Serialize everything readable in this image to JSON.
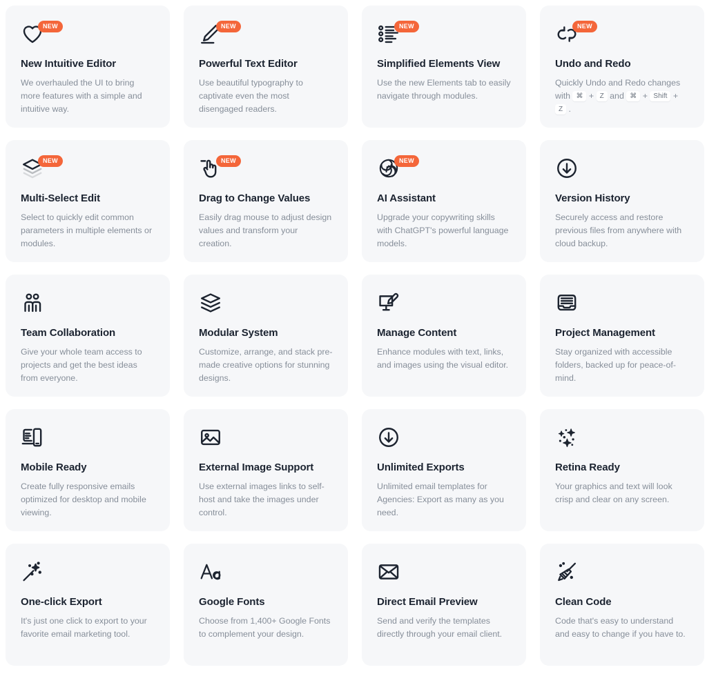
{
  "badge_label": "NEW",
  "accent_color": "#f4663a",
  "card_bg": "#f6f7f9",
  "title_color": "#1b2330",
  "desc_color": "#868e99",
  "cards": [
    {
      "icon": "heart-icon",
      "title": "New Intuitive Editor",
      "desc": "We overhauled the UI to bring more features with a simple and intuitive way.",
      "new": true
    },
    {
      "icon": "pencil-edit-icon",
      "title": "Powerful Text Editor",
      "desc": "Use beautiful typography to captivate even the most disengaged readers.",
      "new": true
    },
    {
      "icon": "elements-list-icon",
      "title": "Simplified Elements View",
      "desc": "Use the new Elements tab to easily navigate through modules.",
      "new": true
    },
    {
      "icon": "undo-redo-icon",
      "title": "Undo and Redo",
      "desc": "Quickly Undo and Redo changes with ",
      "desc_keys": [
        "⌘",
        "+",
        "Z",
        "and",
        "⌘",
        "+",
        "Shift",
        "+",
        "Z",
        "."
      ],
      "new": true
    },
    {
      "icon": "layers-stack-icon",
      "title": "Multi-Select Edit",
      "desc": "Select to quickly edit common parameters in multiple elements or modules.",
      "new": true
    },
    {
      "icon": "drag-hand-icon",
      "title": "Drag to Change Values",
      "desc": "Easily drag mouse to adjust design values and transform your creation.",
      "new": true
    },
    {
      "icon": "openai-spiral-icon",
      "title": "AI Assistant",
      "desc": "Upgrade your copywriting skills with ChatGPT's powerful language models.",
      "new": true
    },
    {
      "icon": "download-circle-icon",
      "title": "Version History",
      "desc": "Securely access and restore previous files from anywhere with cloud backup.",
      "new": false
    },
    {
      "icon": "team-people-icon",
      "title": "Team Collaboration",
      "desc": "Give your whole team access to projects and get the best ideas from everyone.",
      "new": false
    },
    {
      "icon": "modular-layers-icon",
      "title": "Modular System",
      "desc": "Customize, arrange, and stack pre-made creative options for stunning designs.",
      "new": false
    },
    {
      "icon": "monitor-brush-icon",
      "title": "Manage Content",
      "desc": "Enhance modules with text, links, and images using the visual editor.",
      "new": false
    },
    {
      "icon": "archive-tray-icon",
      "title": "Project Management",
      "desc": "Stay organized with accessible folders, backed up for peace-of-mind.",
      "new": false
    },
    {
      "icon": "mobile-device-icon",
      "title": "Mobile Ready",
      "desc": "Create fully responsive emails optimized for desktop and mobile viewing.",
      "new": false
    },
    {
      "icon": "image-picture-icon",
      "title": "External Image Support",
      "desc": "Use external images links to self-host and take the images under control.",
      "new": false
    },
    {
      "icon": "download-circle-icon",
      "title": "Unlimited Exports",
      "desc": "Unlimited email templates for Agencies: Export as many as you need.",
      "new": false
    },
    {
      "icon": "sparkles-icon",
      "title": "Retina Ready",
      "desc": "Your graphics and text will look crisp and clear on any screen.",
      "new": false
    },
    {
      "icon": "magic-wand-icon",
      "title": "One-click Export",
      "desc": "It's just one click to export to your favorite email marketing tool.",
      "new": false
    },
    {
      "icon": "font-aa-icon",
      "title": "Google Fonts",
      "desc": "Choose from 1,400+ Google Fonts to complement your design.",
      "new": false
    },
    {
      "icon": "envelope-icon",
      "title": "Direct Email Preview",
      "desc": "Send and verify the templates directly through your email client.",
      "new": false
    },
    {
      "icon": "broom-clean-icon",
      "title": "Clean Code",
      "desc": "Code that's easy to understand and easy to change if you have to.",
      "new": false
    }
  ]
}
